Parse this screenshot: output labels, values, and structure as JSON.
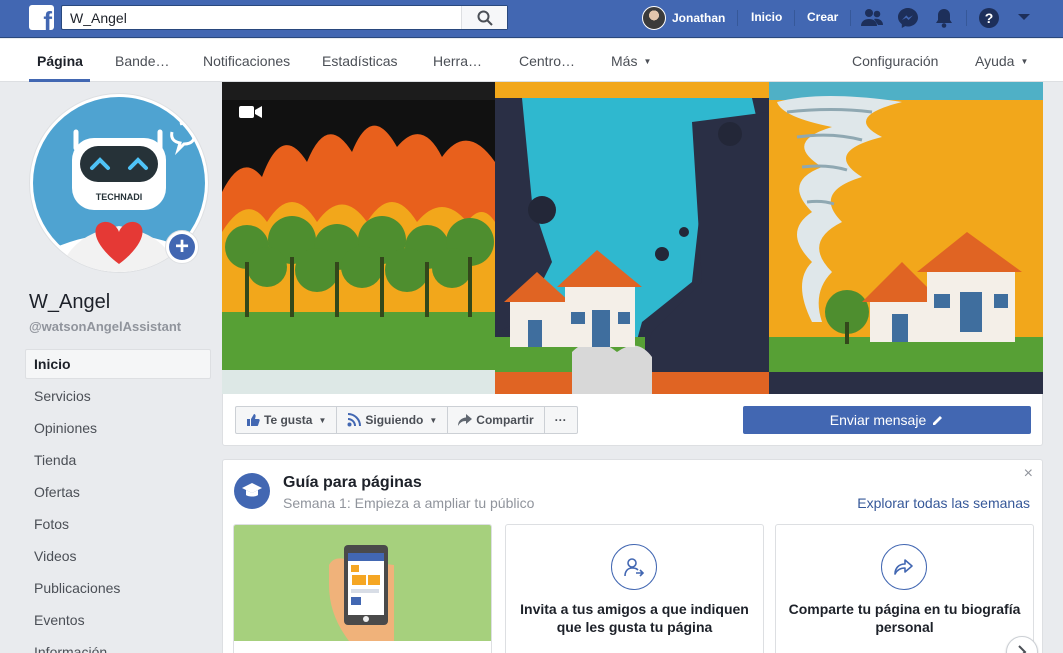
{
  "topbar": {
    "search_value": "W_Angel",
    "user_name": "Jonathan",
    "link_home": "Inicio",
    "link_create": "Crear"
  },
  "pagenav": {
    "items": [
      "Página",
      "Bande…",
      "Notificaciones",
      "Estadísticas",
      "Herra…",
      "Centro…",
      "Más"
    ],
    "settings": "Configuración",
    "help": "Ayuda"
  },
  "profile": {
    "robot_label": "TECHNADI",
    "name": "W_Angel",
    "handle": "@watsonAngelAssistant"
  },
  "sidebar": {
    "items": [
      "Inicio",
      "Servicios",
      "Opiniones",
      "Tienda",
      "Ofertas",
      "Fotos",
      "Videos",
      "Publicaciones",
      "Eventos",
      "Información"
    ]
  },
  "actions": {
    "like": "Te gusta",
    "following": "Siguiendo",
    "share": "Compartir",
    "more": "···",
    "send_message": "Enviar mensaje"
  },
  "guide": {
    "title": "Guía para páginas",
    "subtitle": "Semana 1: Empieza a ampliar tu público",
    "explore": "Explorar todas las semanas",
    "close": "×",
    "cards": [
      {
        "title": ""
      },
      {
        "title": "Invita a tus amigos a que indiquen que les gusta tu página"
      },
      {
        "title": "Comparte tu página en tu biografía personal"
      }
    ]
  },
  "colors": {
    "brand": "#4267b2",
    "link": "#365899",
    "muted": "#90949c"
  }
}
